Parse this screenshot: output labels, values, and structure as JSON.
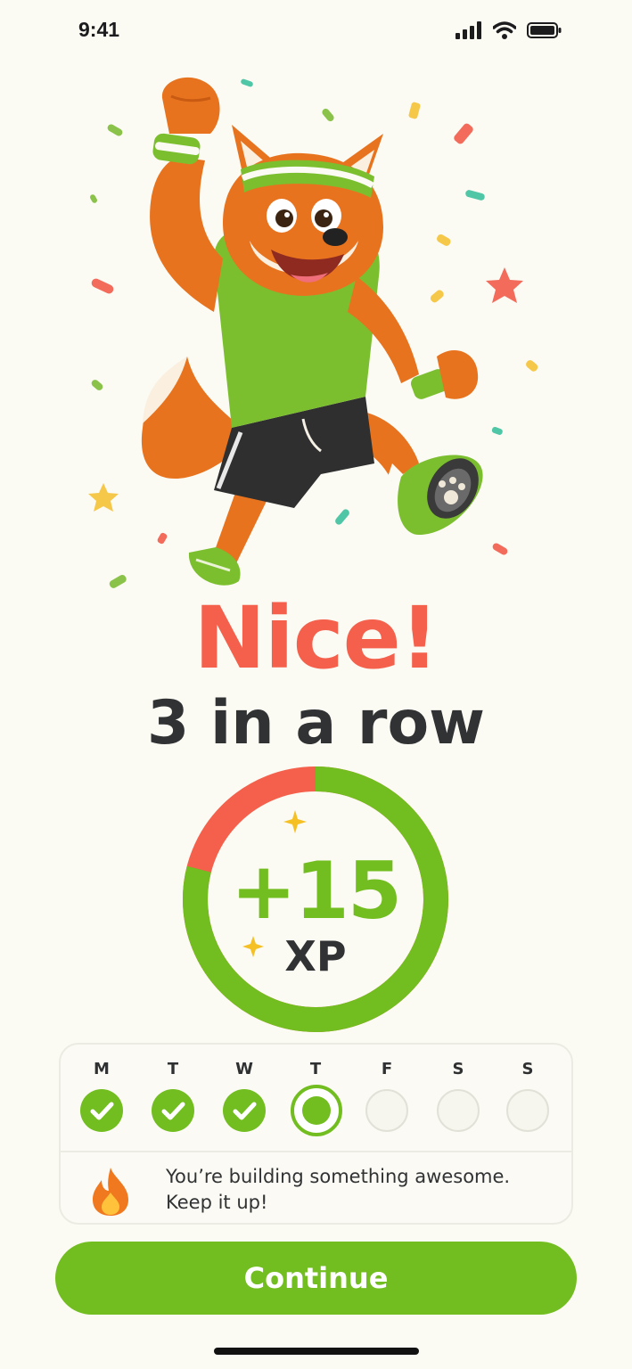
{
  "status_bar": {
    "time": "9:41"
  },
  "headline": {
    "title": "Nice!",
    "subtitle": "3 in a row"
  },
  "reward": {
    "amount": "+15",
    "unit": "XP",
    "ring_fill_fraction": 0.79
  },
  "week": {
    "days": [
      {
        "letter": "M",
        "state": "done"
      },
      {
        "letter": "T",
        "state": "done"
      },
      {
        "letter": "W",
        "state": "done"
      },
      {
        "letter": "T",
        "state": "today"
      },
      {
        "letter": "F",
        "state": "empty"
      },
      {
        "letter": "S",
        "state": "empty"
      },
      {
        "letter": "S",
        "state": "empty"
      }
    ]
  },
  "message": {
    "icon": "flame-icon",
    "text": "You’re building something awesome. Keep it up!"
  },
  "actions": {
    "continue_label": "Continue"
  },
  "colors": {
    "accent_green": "#72bd1f",
    "accent_red": "#f4604b",
    "background": "#fbfaf3",
    "text_dark": "#303233"
  }
}
